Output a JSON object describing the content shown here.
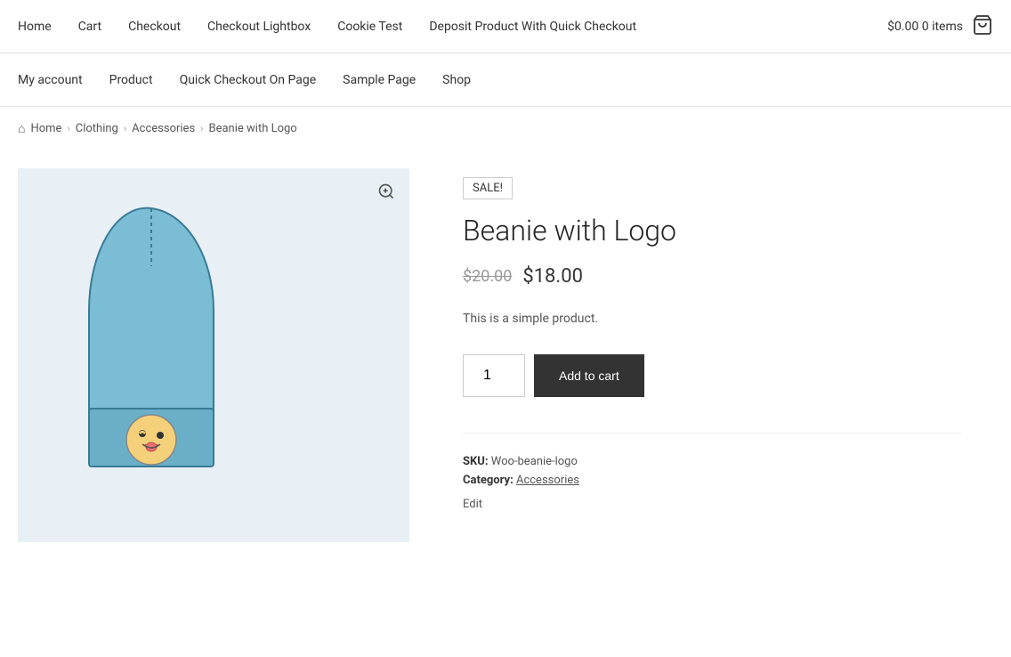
{
  "site": {
    "currency": "$0.00",
    "cart_items": "0 items"
  },
  "top_nav": {
    "links": [
      {
        "label": "Home",
        "href": "#"
      },
      {
        "label": "Cart",
        "href": "#"
      },
      {
        "label": "Checkout",
        "href": "#"
      },
      {
        "label": "Checkout Lightbox",
        "href": "#"
      },
      {
        "label": "Cookie Test",
        "href": "#"
      },
      {
        "label": "Deposit Product With Quick Checkout",
        "href": "#"
      }
    ]
  },
  "second_nav": {
    "links": [
      {
        "label": "My account",
        "href": "#"
      },
      {
        "label": "Product",
        "href": "#"
      },
      {
        "label": "Quick Checkout On Page",
        "href": "#"
      },
      {
        "label": "Sample Page",
        "href": "#"
      },
      {
        "label": "Shop",
        "href": "#"
      }
    ]
  },
  "breadcrumb": {
    "home_label": "Home",
    "crumbs": [
      {
        "label": "Clothing",
        "href": "#"
      },
      {
        "label": "Accessories",
        "href": "#"
      },
      {
        "label": "Beanie with Logo",
        "href": null
      }
    ]
  },
  "product": {
    "sale_badge": "SALE!",
    "title": "Beanie with Logo",
    "original_price": "$20.00",
    "sale_price": "$18.00",
    "description": "This is a simple product.",
    "quantity": "1",
    "add_to_cart_label": "Add to cart",
    "sku_label": "SKU:",
    "sku_value": "Woo-beanie-logo",
    "category_label": "Category:",
    "category_value": "Accessories",
    "category_href": "#",
    "edit_label": "Edit"
  },
  "icons": {
    "zoom": "🔍",
    "cart": "🛒",
    "home": "⌂"
  }
}
